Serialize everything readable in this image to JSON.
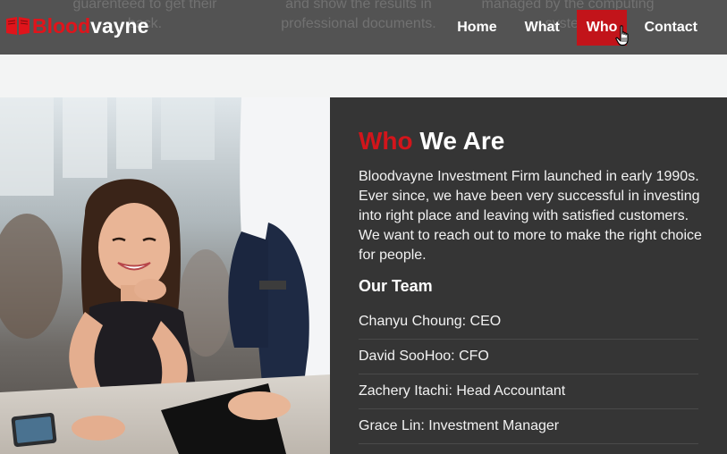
{
  "header": {
    "background_text": [
      [
        "guarenteed to get their",
        "back."
      ],
      [
        "and show the results in",
        "professional documents."
      ],
      [
        "managed by the computing",
        "system"
      ]
    ],
    "logo": {
      "part1": "Blood",
      "part2": "vayne",
      "icon": "book-icon"
    },
    "nav": [
      {
        "label": "Home"
      },
      {
        "label": "What"
      },
      {
        "label": "Who"
      },
      {
        "label": "Contact"
      }
    ]
  },
  "about": {
    "title_accent": "Who",
    "title_rest": "We Are",
    "description": "Bloodvayne Investment Firm launched in early 1990s. Ever since, we have been very successful in investing into right place and leaving with satisfied customers. We want to reach out to more to make the right choice for people.",
    "team_heading": "Our Team",
    "team": [
      "Chanyu Choung: CEO",
      "David SooHoo: CFO",
      "Zachery Itachi: Head Accountant",
      "Grace Lin: Investment Manager"
    ]
  },
  "colors": {
    "accent_red": "#d2151b",
    "nav_active": "#c2141a",
    "header_bg": "#535353",
    "panel_bg": "#353535"
  }
}
